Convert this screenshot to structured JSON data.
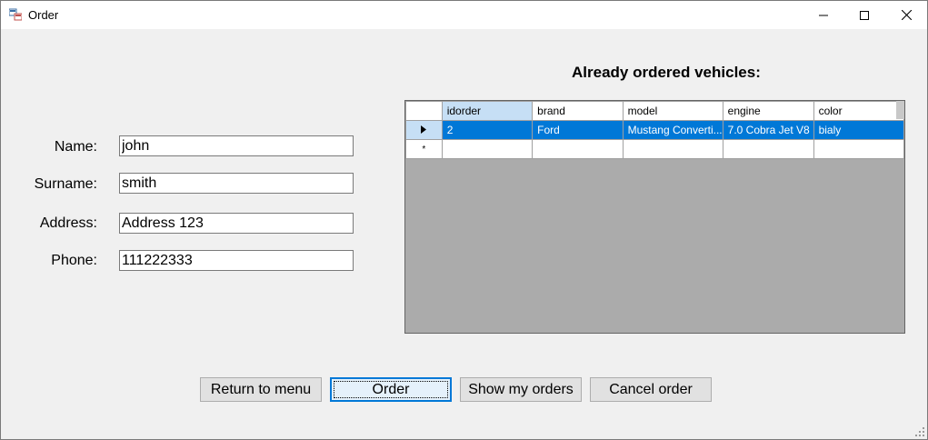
{
  "window": {
    "title": "Order"
  },
  "form": {
    "name_label": "Name:",
    "name_value": "john",
    "surname_label": "Surname:",
    "surname_value": "smith",
    "address_label": "Address:",
    "address_value": "Address 123",
    "phone_label": "Phone:",
    "phone_value": "111222333"
  },
  "grid": {
    "title": "Already ordered vehicles:",
    "columns": [
      "idorder",
      "brand",
      "model",
      "engine",
      "color"
    ],
    "rows": [
      [
        "2",
        "Ford",
        "Mustang Converti...",
        "7.0 Cobra Jet V8",
        "bialy"
      ]
    ],
    "new_row_marker": "*"
  },
  "buttons": {
    "return": "Return to menu",
    "order": "Order",
    "show_orders": "Show my orders",
    "cancel": "Cancel order"
  },
  "colors": {
    "selection": "#0078d7",
    "grid_background": "#ababab",
    "window_background": "#f0f0f0"
  }
}
